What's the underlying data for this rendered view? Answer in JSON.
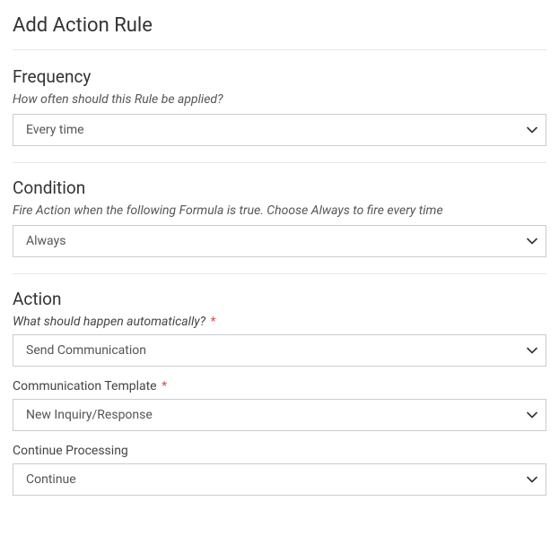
{
  "page": {
    "title": "Add Action Rule"
  },
  "sections": {
    "frequency": {
      "title": "Frequency",
      "help": "How often should this Rule be applied?",
      "select_value": "Every time"
    },
    "condition": {
      "title": "Condition",
      "help": "Fire Action when the following Formula is true. Choose Always to fire every time",
      "select_value": "Always"
    },
    "action": {
      "title": "Action",
      "help_label": "What should happen automatically?",
      "action_value": "Send Communication",
      "template_label": "Communication Template",
      "template_value": "New Inquiry/Response",
      "continue_label": "Continue Processing",
      "continue_value": "Continue"
    }
  },
  "required_marker": "*"
}
